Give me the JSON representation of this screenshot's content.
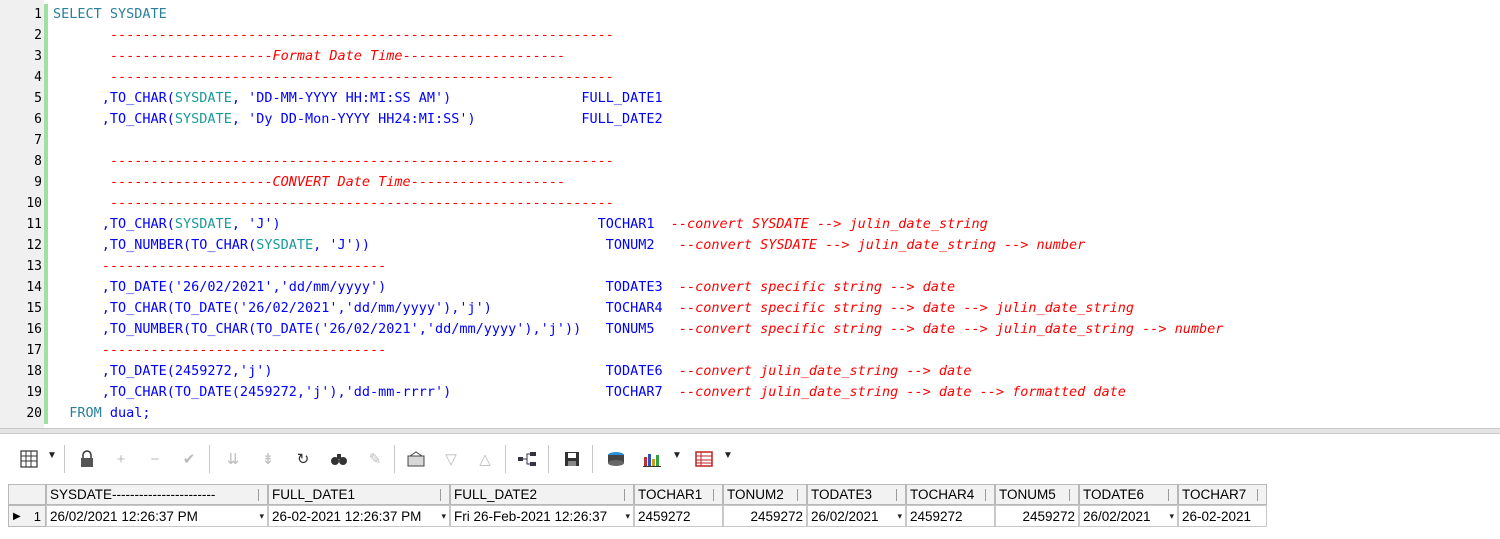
{
  "editor": {
    "line_numbers": [
      "1",
      "2",
      "3",
      "4",
      "5",
      "6",
      "7",
      "8",
      "9",
      "10",
      "11",
      "12",
      "13",
      "14",
      "15",
      "16",
      "17",
      "18",
      "19",
      "20"
    ],
    "lines": [
      {
        "segments": [
          {
            "c": "kw",
            "t": "SELECT SYSDATE"
          }
        ]
      },
      {
        "segments": [
          {
            "c": "dash",
            "t": "       --------------------------------------------------------------"
          }
        ]
      },
      {
        "segments": [
          {
            "c": "dash",
            "t": "       --------------------"
          },
          {
            "c": "cm",
            "t": "Format Date Time"
          },
          {
            "c": "dash",
            "t": "--------------------"
          }
        ]
      },
      {
        "segments": [
          {
            "c": "dash",
            "t": "       --------------------------------------------------------------"
          }
        ]
      },
      {
        "segments": [
          {
            "c": "pl",
            "t": "      ,TO_CHAR("
          },
          {
            "c": "sysd",
            "t": "SYSDATE"
          },
          {
            "c": "pl",
            "t": ", 'DD-MM-YYYY HH:MI:SS AM')                FULL_DATE1"
          }
        ]
      },
      {
        "segments": [
          {
            "c": "pl",
            "t": "      ,TO_CHAR("
          },
          {
            "c": "sysd",
            "t": "SYSDATE"
          },
          {
            "c": "pl",
            "t": ", 'Dy DD-Mon-YYYY HH24:MI:SS')             FULL_DATE2"
          }
        ]
      },
      {
        "segments": [
          {
            "c": "pl",
            "t": ""
          }
        ]
      },
      {
        "segments": [
          {
            "c": "dash",
            "t": "       --------------------------------------------------------------"
          }
        ]
      },
      {
        "segments": [
          {
            "c": "dash",
            "t": "       --------------------"
          },
          {
            "c": "cm",
            "t": "CONVERT Date Time"
          },
          {
            "c": "dash",
            "t": "-------------------"
          }
        ]
      },
      {
        "segments": [
          {
            "c": "dash",
            "t": "       --------------------------------------------------------------"
          }
        ]
      },
      {
        "segments": [
          {
            "c": "pl",
            "t": "      ,TO_CHAR("
          },
          {
            "c": "sysd",
            "t": "SYSDATE"
          },
          {
            "c": "pl",
            "t": ", 'J')                                       TOCHAR1  "
          },
          {
            "c": "cm",
            "t": "--convert SYSDATE --> julin_date_string"
          }
        ]
      },
      {
        "segments": [
          {
            "c": "pl",
            "t": "      ,TO_NUMBER(TO_CHAR("
          },
          {
            "c": "sysd",
            "t": "SYSDATE"
          },
          {
            "c": "pl",
            "t": ", 'J'))                             TONUM2   "
          },
          {
            "c": "cm",
            "t": "--convert SYSDATE --> julin_date_string --> number"
          }
        ]
      },
      {
        "segments": [
          {
            "c": "dash",
            "t": "      -----------------------------------"
          }
        ]
      },
      {
        "segments": [
          {
            "c": "pl",
            "t": "      ,TO_DATE('26/02/2021','dd/mm/yyyy')                           TODATE3  "
          },
          {
            "c": "cm",
            "t": "--convert specific string --> date"
          }
        ]
      },
      {
        "segments": [
          {
            "c": "pl",
            "t": "      ,TO_CHAR(TO_DATE('26/02/2021','dd/mm/yyyy'),'j')              TOCHAR4  "
          },
          {
            "c": "cm",
            "t": "--convert specific string --> date --> julin_date_string"
          }
        ]
      },
      {
        "segments": [
          {
            "c": "pl",
            "t": "      ,TO_NUMBER(TO_CHAR(TO_DATE('26/02/2021','dd/mm/yyyy'),'j'))   TONUM5   "
          },
          {
            "c": "cm",
            "t": "--convert specific string --> date --> julin_date_string --> number"
          }
        ]
      },
      {
        "segments": [
          {
            "c": "dash",
            "t": "      -----------------------------------"
          }
        ]
      },
      {
        "segments": [
          {
            "c": "pl",
            "t": "      ,TO_DATE(2459272,'j')                                         TODATE6  "
          },
          {
            "c": "cm",
            "t": "--convert julin_date_string --> date"
          }
        ]
      },
      {
        "segments": [
          {
            "c": "pl",
            "t": "      ,TO_CHAR(TO_DATE(2459272,'j'),'dd-mm-rrrr')                   TOCHAR7  "
          },
          {
            "c": "cm",
            "t": "--convert julin_date_string --> date --> formatted date"
          }
        ]
      },
      {
        "segments": [
          {
            "c": "kw",
            "t": "  FROM"
          },
          {
            "c": "pl",
            "t": " dual;"
          }
        ]
      }
    ]
  },
  "toolbar": {
    "icons": [
      "grid-view-icon",
      "lock-icon",
      "add-icon",
      "remove-icon",
      "check-icon",
      "fetch-next-icon",
      "fetch-all-icon",
      "refresh-icon",
      "find-icon",
      "clear-icon",
      "export-icon",
      "filter-down-icon",
      "filter-up-icon",
      "link-icon",
      "save-icon",
      "print-icon",
      "chart-icon",
      "table-icon"
    ]
  },
  "grid": {
    "row_number": "1",
    "columns": [
      {
        "header": "SYSDATE-----------------------",
        "value": "26/02/2021 12:26:37 PM",
        "dropdown": true,
        "num": false
      },
      {
        "header": "FULL_DATE1",
        "value": "26-02-2021 12:26:37 PM",
        "dropdown": true,
        "num": false
      },
      {
        "header": "FULL_DATE2",
        "value": "Fri 26-Feb-2021 12:26:37",
        "dropdown": true,
        "num": false
      },
      {
        "header": "TOCHAR1",
        "value": "2459272",
        "dropdown": false,
        "num": false
      },
      {
        "header": "TONUM2",
        "value": "2459272",
        "dropdown": false,
        "num": true
      },
      {
        "header": "TODATE3",
        "value": "26/02/2021",
        "dropdown": true,
        "num": false
      },
      {
        "header": "TOCHAR4",
        "value": "2459272",
        "dropdown": false,
        "num": false
      },
      {
        "header": "TONUM5",
        "value": "2459272",
        "dropdown": false,
        "num": true
      },
      {
        "header": "TODATE6",
        "value": "26/02/2021",
        "dropdown": true,
        "num": false
      },
      {
        "header": "TOCHAR7",
        "value": "26-02-2021",
        "dropdown": false,
        "num": false
      }
    ]
  }
}
